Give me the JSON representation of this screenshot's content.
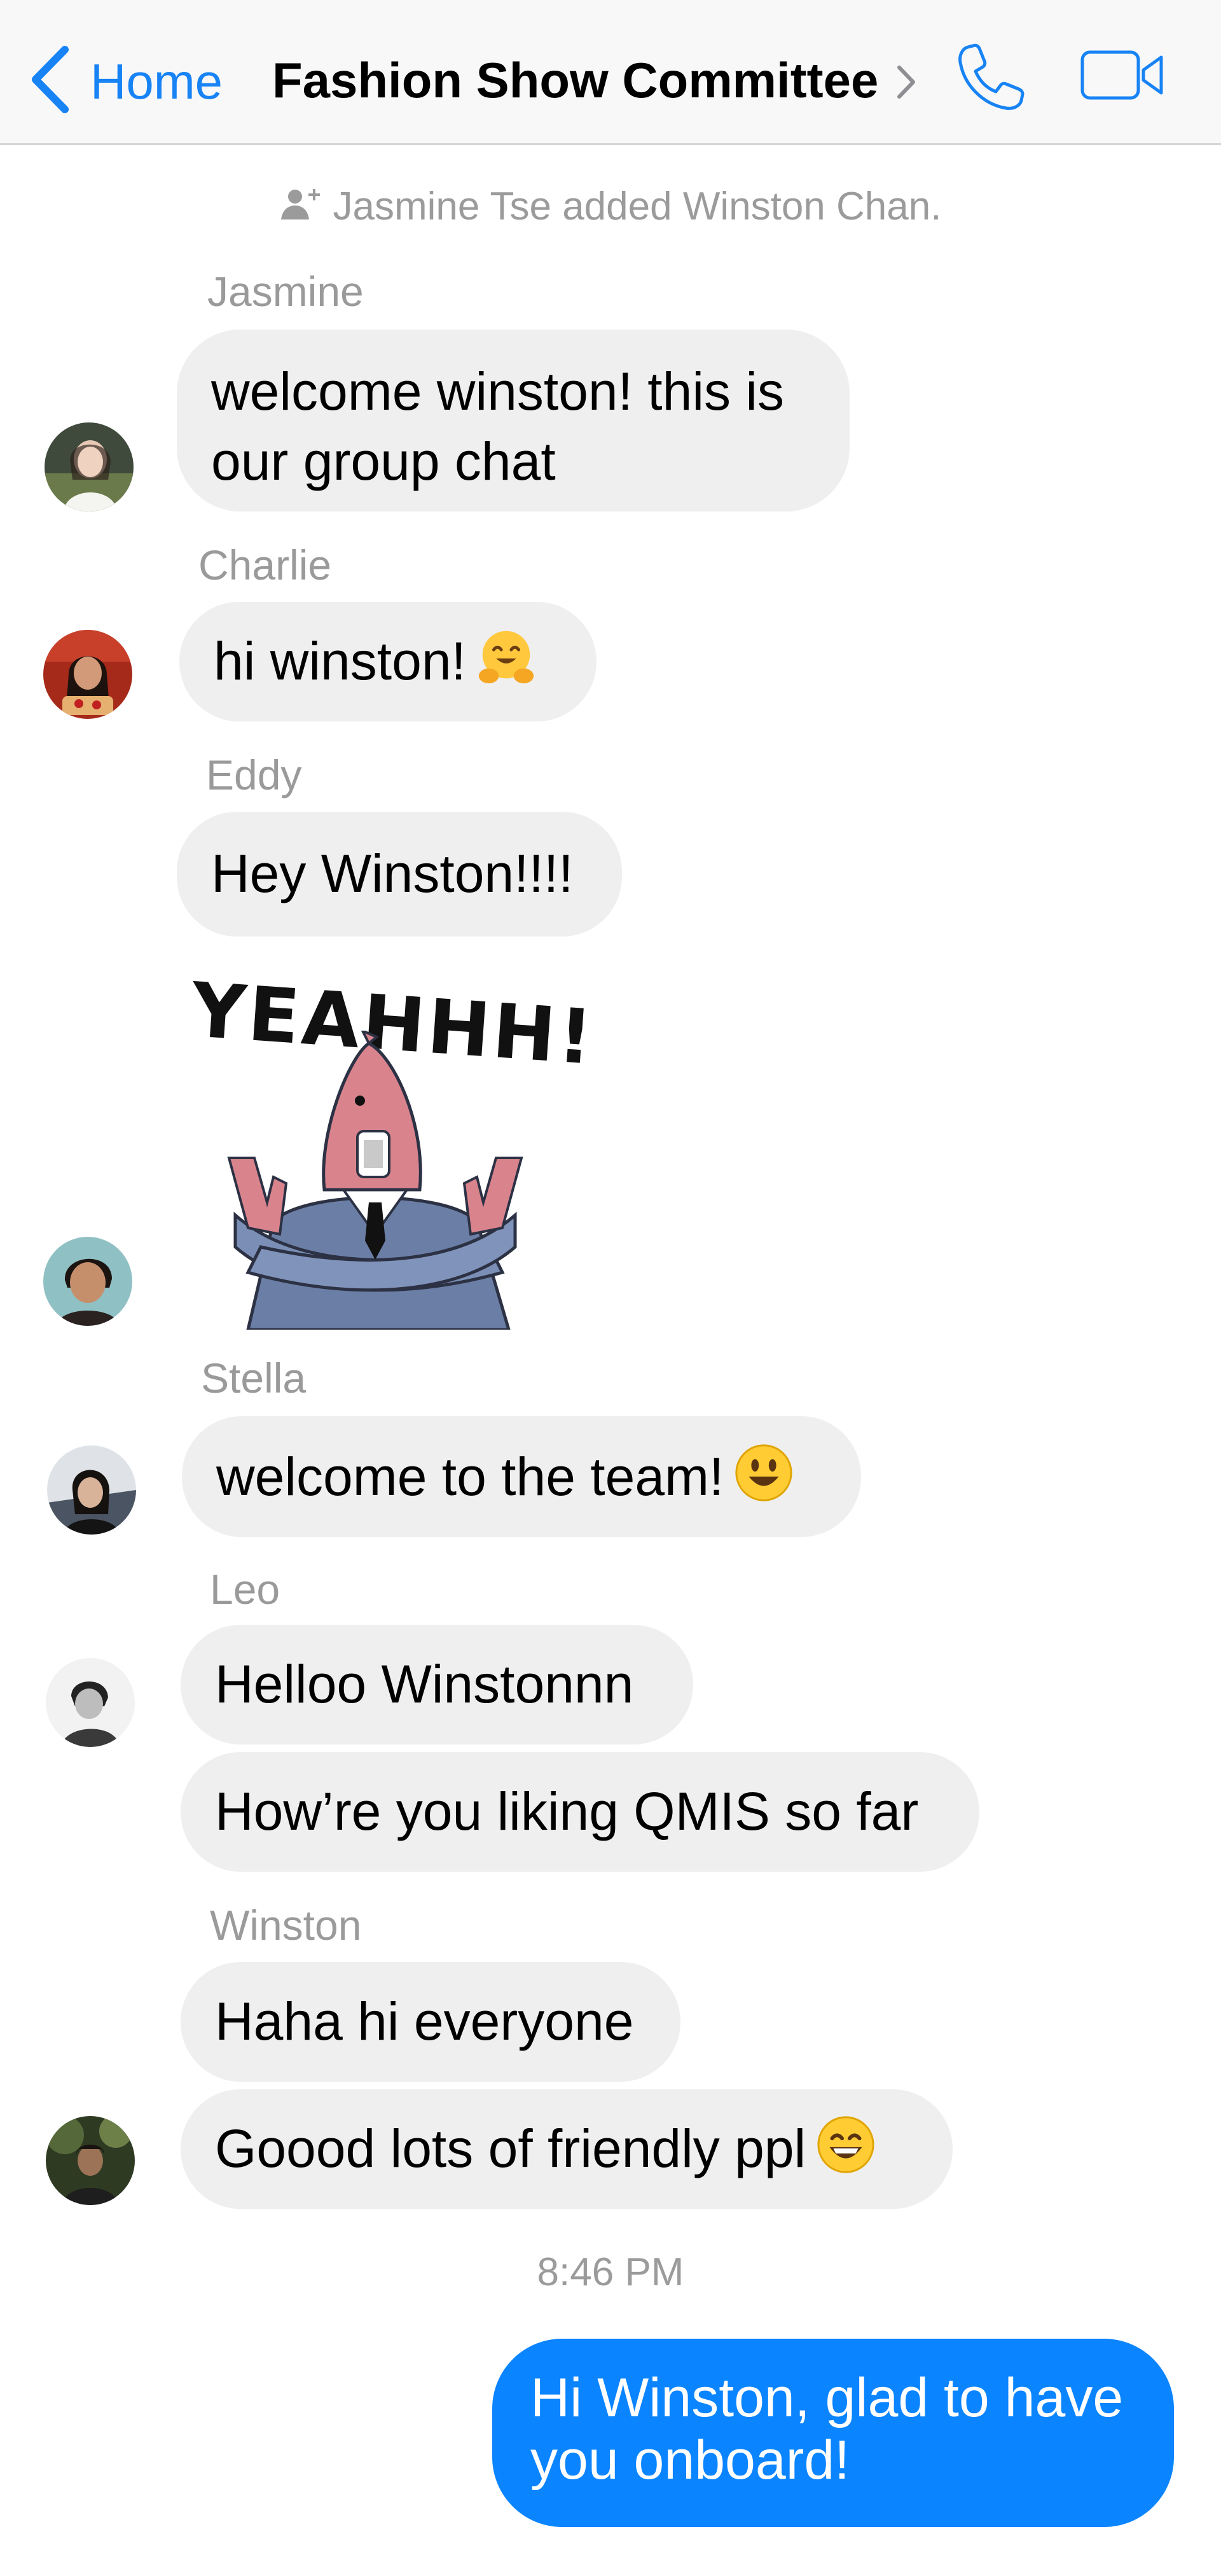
{
  "nav": {
    "back_label": "Home",
    "title": "Fashion Show Committee",
    "accent_color": "#1783f5",
    "icons": [
      "chevron-left-icon",
      "chevron-right-icon",
      "phone-icon",
      "video-camera-icon"
    ]
  },
  "system_notice": {
    "icon": "add-person-icon",
    "text": "Jasmine Tse added Winston Chan."
  },
  "messages": {
    "jasmine": {
      "sender": "Jasmine",
      "line1": "welcome winston! this is",
      "line2": "our group chat"
    },
    "charlie": {
      "sender": "Charlie",
      "text": "hi winston!",
      "emoji": "hugging-face-emoji"
    },
    "eddy": {
      "sender": "Eddy",
      "text": "Hey Winston!!!!",
      "sticker_text": "YEAHHH!",
      "sticker": "yeahhh-fish-sticker"
    },
    "stella": {
      "sender": "Stella",
      "text": "welcome to the team!",
      "emoji": "smiley-emoji"
    },
    "leo": {
      "sender": "Leo",
      "text1": "Helloo Winstonnn",
      "text2": "How’re you liking QMIS so far"
    },
    "winston": {
      "sender": "Winston",
      "text1": "Haha hi everyone",
      "text2": "Goood lots of friendly ppl",
      "emoji": "grinning-emoji"
    }
  },
  "timestamp": "8:46 PM",
  "my_message": {
    "line1": "Hi Winston, glad to have",
    "line2": "you onboard!",
    "color": "#0a84ff"
  }
}
